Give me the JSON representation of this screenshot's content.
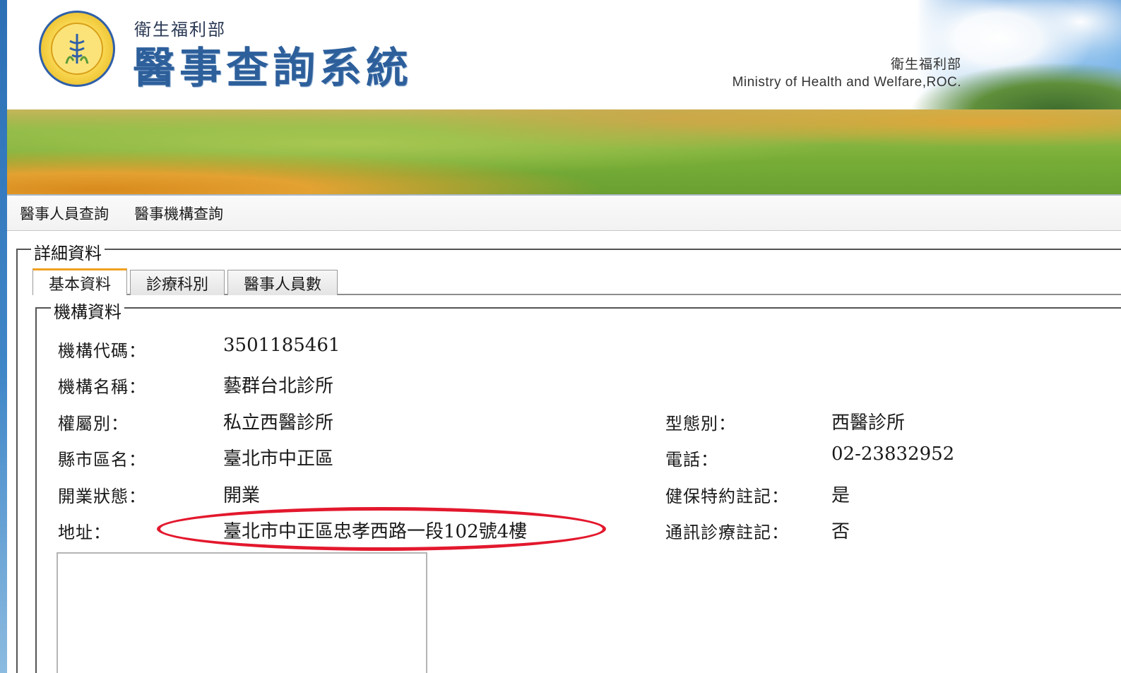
{
  "header": {
    "agency_small": "衛生福利部",
    "system_title": "醫事查詢系統",
    "ministry_zh": "衛生福利部",
    "ministry_en": "Ministry of Health and Welfare,ROC."
  },
  "nav": {
    "items": [
      "醫事人員查詢",
      "醫事機構查詢"
    ]
  },
  "detail": {
    "legend": "詳細資料",
    "tabs": [
      "基本資料",
      "診療科別",
      "醫事人員數"
    ],
    "active_tab": "基本資料",
    "section_legend": "機構資料",
    "left_fields": [
      {
        "label": "機構代碼：",
        "value": "3501185461"
      },
      {
        "label": "機構名稱：",
        "value": "藝群台北診所"
      },
      {
        "label": "權屬別：",
        "value": "私立西醫診所"
      },
      {
        "label": "縣市區名：",
        "value": "臺北市中正區"
      },
      {
        "label": "開業狀態：",
        "value": "開業"
      },
      {
        "label": "地址：",
        "value": "臺北市中正區忠孝西路一段102號4樓"
      }
    ],
    "right_fields": [
      {
        "label": "型態別：",
        "value": "西醫診所"
      },
      {
        "label": "電話：",
        "value": "02-23832952"
      },
      {
        "label": "健保特約註記：",
        "value": "是"
      },
      {
        "label": "通訊診療註記：",
        "value": "否"
      }
    ]
  },
  "colors": {
    "annotation": "#e3182d",
    "title_blue": "#2d5f9b",
    "tab_accent": "#f0a020"
  }
}
